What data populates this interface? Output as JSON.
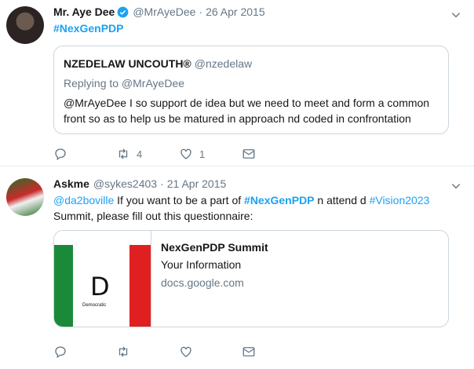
{
  "tweet1": {
    "name": "Mr. Aye Dee",
    "verified": true,
    "handle": "@MrAyeDee",
    "separator": "·",
    "date": "26 Apr 2015",
    "text_hashtag": "#NexGenPDP",
    "quote": {
      "name": "NZEDELAW UNCOUTH®",
      "handle": "@nzedelaw",
      "replying_to": "Replying to @MrAyeDee",
      "text": "@MrAyeDee I so support de idea but we need to meet and form a common front so as to help us be matured in approach nd coded in confrontation"
    },
    "actions": {
      "retweet_count": "4",
      "like_count": "1"
    }
  },
  "tweet2": {
    "name": "Askme",
    "handle": "@sykes2403",
    "separator": "·",
    "date": "21 Apr 2015",
    "text": {
      "mention": "@da2boville",
      "part1": " If you want to be a part of ",
      "hashtag1": "#NexGenPDP",
      "part2": " n attend d ",
      "hashtag2": "#Vision2023",
      "part3": " Summit, please fill out this questionnaire:"
    },
    "card": {
      "title": "NexGenPDP Summit",
      "description": "Your Information",
      "domain": "docs.google.com",
      "image_text_d": "D",
      "image_text_democratic": "Democratic"
    },
    "actions": {
      "retweet_count": "",
      "like_count": ""
    }
  },
  "colors": {
    "accent": "#1da1f2",
    "muted": "#657786",
    "border": "#e6ecf0",
    "pdp_green": "#1a8a3a",
    "pdp_red": "#e02020"
  }
}
